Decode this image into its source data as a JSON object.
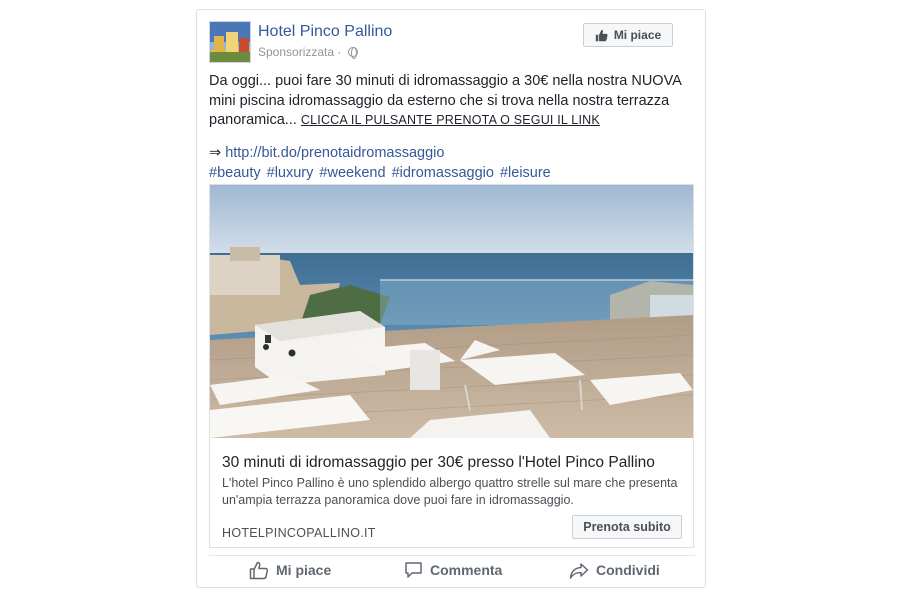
{
  "post": {
    "page_name": "Hotel Pinco Pallino",
    "sponsored_label": "Sponsorizzata",
    "separator": "·",
    "like_page_label": "Mi piace",
    "text": "Da oggi... puoi fare 30 minuti di idromassaggio a 30€ nella nostra NUOVA mini piscina idromassaggio da esterno che si trova nella nostra terrazza panoramica...",
    "cta_text": "CLICCA IL PULSANTE PRENOTA O SEGUI IL LINK",
    "link_arrow": "⇒",
    "link_url": "http://bit.do/prenotaidromassaggio",
    "hashtags": [
      "#beauty",
      "#luxury",
      "#weekend",
      "#idromassaggio",
      "#leisure"
    ]
  },
  "ad": {
    "title": "30 minuti di idromassaggio per 30€ presso l'Hotel Pinco Pallino",
    "description": "L'hotel Pinco Pallino è uno splendido albergo quattro strelle sul mare che presenta un'ampia terrazza panoramica dove puoi fare in idromassaggio.",
    "domain": "HOTELPINCOPALLINO.IT",
    "button_label": "Prenota subito"
  },
  "actions": {
    "like": "Mi piace",
    "comment": "Commenta",
    "share": "Condividi"
  },
  "icons": {
    "globe": "globe-icon",
    "thumbs_up": "thumbs-up-icon",
    "comment": "comment-icon",
    "share": "share-arrow-icon"
  },
  "colors": {
    "link": "#365899",
    "meta_gray": "#90949c",
    "action_gray": "#606770",
    "border": "#dddfe2"
  }
}
